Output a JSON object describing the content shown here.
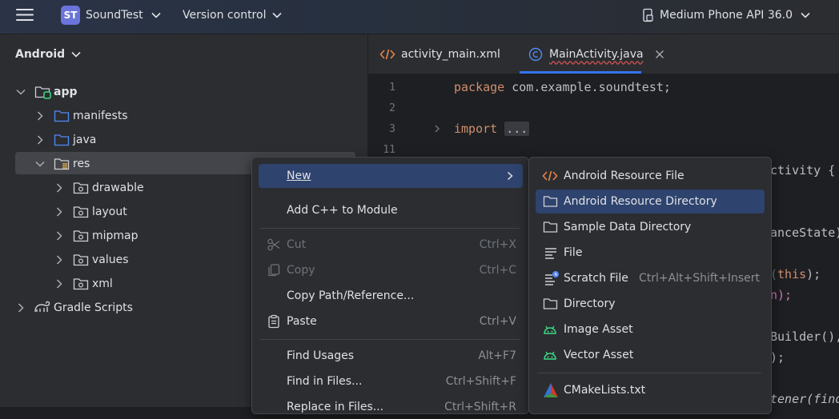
{
  "topbar": {
    "project_badge": "ST",
    "project_name": "SoundTest",
    "version_control": "Version control",
    "device": "Medium Phone API 36.0"
  },
  "project_panel": {
    "title": "Android",
    "tree": [
      {
        "label": "app",
        "bold": true
      },
      {
        "label": "manifests"
      },
      {
        "label": "java"
      },
      {
        "label": "res"
      },
      {
        "label": "drawable"
      },
      {
        "label": "layout"
      },
      {
        "label": "mipmap"
      },
      {
        "label": "values"
      },
      {
        "label": "xml"
      },
      {
        "label": "Gradle Scripts"
      }
    ]
  },
  "editor": {
    "tabs": [
      {
        "label": "activity_main.xml"
      },
      {
        "label": "MainActivity.java",
        "active": true
      }
    ],
    "line_numbers": [
      "1",
      "2",
      "3",
      "11"
    ],
    "code": {
      "line1_kw": "package",
      "line1_rest": " com.example.soundtest;",
      "line3_kw": "import",
      "line3_fold": "...",
      "frag_activity": "ctivity {",
      "frag_state": "anceState)",
      "frag_this_kw": "this",
      "frag_this_end": ");",
      "frag_n": "n);",
      "frag_builder": "Builder(),",
      "frag_paren": ");",
      "frag_tener": "tener(find"
    }
  },
  "context_menu": {
    "items": [
      {
        "label": "New",
        "mnemonic": "N",
        "has_submenu": true
      },
      {
        "label": "Add C++ to Module"
      },
      {
        "label": "Cut",
        "shortcut": "Ctrl+X",
        "disabled": true
      },
      {
        "label": "Copy",
        "shortcut": "Ctrl+C",
        "disabled": true
      },
      {
        "label": "Copy Path/Reference..."
      },
      {
        "label": "Paste",
        "shortcut": "Ctrl+V"
      },
      {
        "label": "Find Usages",
        "shortcut": "Alt+F7"
      },
      {
        "label": "Find in Files...",
        "shortcut": "Ctrl+Shift+F"
      },
      {
        "label": "Replace in Files...",
        "shortcut": "Ctrl+Shift+R"
      }
    ]
  },
  "new_submenu": {
    "items": [
      {
        "label": "Android Resource File",
        "icon": "xml-icon"
      },
      {
        "label": "Android Resource Directory",
        "icon": "folder-icon",
        "selected": true
      },
      {
        "label": "Sample Data Directory",
        "icon": "folder-icon"
      },
      {
        "label": "File",
        "icon": "file-icon"
      },
      {
        "label": "Scratch File",
        "icon": "scratch-file-icon",
        "shortcut": "Ctrl+Alt+Shift+Insert"
      },
      {
        "label": "Directory",
        "icon": "folder-icon"
      },
      {
        "label": "Image Asset",
        "icon": "android-icon"
      },
      {
        "label": "Vector Asset",
        "icon": "android-icon"
      },
      {
        "label": "CMakeLists.txt",
        "icon": "cmake-icon"
      }
    ]
  },
  "colors": {
    "accent": "#3574f0",
    "selection": "#2e436e",
    "keyword": "#cf8e6d",
    "android_green": "#3ddc84"
  }
}
